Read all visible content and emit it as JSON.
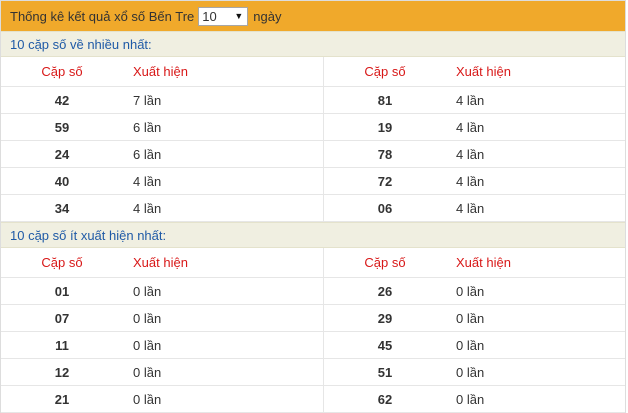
{
  "topbar": {
    "label": "Thống kê kết quả xổ số Bến Tre",
    "selected_days": "10",
    "suffix": "ngày"
  },
  "most": {
    "title": "10 cặp số về nhiều nhất:",
    "col_pair": "Cặp số",
    "col_count": "Xuất hiện",
    "rows": [
      {
        "a": "42",
        "ac": "7 lần",
        "b": "81",
        "bc": "4 lần"
      },
      {
        "a": "59",
        "ac": "6 lần",
        "b": "19",
        "bc": "4 lần"
      },
      {
        "a": "24",
        "ac": "6 lần",
        "b": "78",
        "bc": "4 lần"
      },
      {
        "a": "40",
        "ac": "4 lần",
        "b": "72",
        "bc": "4 lần"
      },
      {
        "a": "34",
        "ac": "4 lần",
        "b": "06",
        "bc": "4 lần"
      }
    ]
  },
  "least": {
    "title": "10 cặp số ít xuất hiện nhất:",
    "col_pair": "Cặp số",
    "col_count": "Xuất hiện",
    "rows": [
      {
        "a": "01",
        "ac": "0 lần",
        "b": "26",
        "bc": "0 lần"
      },
      {
        "a": "07",
        "ac": "0 lần",
        "b": "29",
        "bc": "0 lần"
      },
      {
        "a": "11",
        "ac": "0 lần",
        "b": "45",
        "bc": "0 lần"
      },
      {
        "a": "12",
        "ac": "0 lần",
        "b": "51",
        "bc": "0 lần"
      },
      {
        "a": "21",
        "ac": "0 lần",
        "b": "62",
        "bc": "0 lần"
      }
    ]
  },
  "colors": {
    "topbar_bg": "#f0a92b",
    "section_bg": "#f0efe1",
    "section_text": "#1f5aa6",
    "header_text": "#d81818"
  }
}
